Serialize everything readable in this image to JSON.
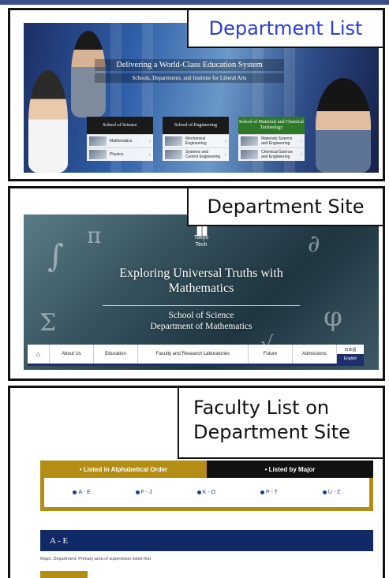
{
  "callouts": {
    "department_list": "Department List",
    "department_site": "Department Site",
    "faculty_list_line1": "Faculty List on",
    "faculty_list_line2": "Department Site"
  },
  "colors": {
    "callout_blue": "#2a3bd8",
    "navy": "#0f2a66",
    "gold": "#b48e14",
    "frame": "#111111"
  },
  "panel1": {
    "banner_title": "Delivering a World-Class Education System",
    "banner_subtitle": "Schools, Departments, and Institute for Liberal Arts",
    "schools": [
      {
        "name": "School of Science",
        "color": "#1a1a1a",
        "rows": [
          "Mathematics",
          "Physics"
        ]
      },
      {
        "name": "School of Engineering",
        "color": "#1a1a1a",
        "rows": [
          "Mechanical Engineering",
          "Systems and Control Engineering"
        ]
      },
      {
        "name": "School of Materials and Chemical Technology",
        "color": "#2f7a2a",
        "rows": [
          "Materials Science and Engineering",
          "Chemical Science and Engineering"
        ]
      }
    ]
  },
  "panel2": {
    "logo_text": "Tokyo Tech",
    "headline_line1": "Exploring Universal Truths with",
    "headline_line2": "Mathematics",
    "school": "School of Science",
    "department": "Department of Mathematics",
    "nav": [
      "About Us",
      "Education",
      "Faculty and Research Laboratories",
      "Future",
      "Admissions"
    ],
    "lang_ja": "日本語",
    "lang_en": "English"
  },
  "panel3": {
    "tab_alpha": "Listed in Alphabetical Order",
    "tab_major": "Listed by Major",
    "letters": [
      "A - E",
      "F - J",
      "K - O",
      "P - T",
      "U - Z"
    ],
    "section_title": "A - E",
    "note": "Major, Department: Primary area of supervision listed first"
  }
}
